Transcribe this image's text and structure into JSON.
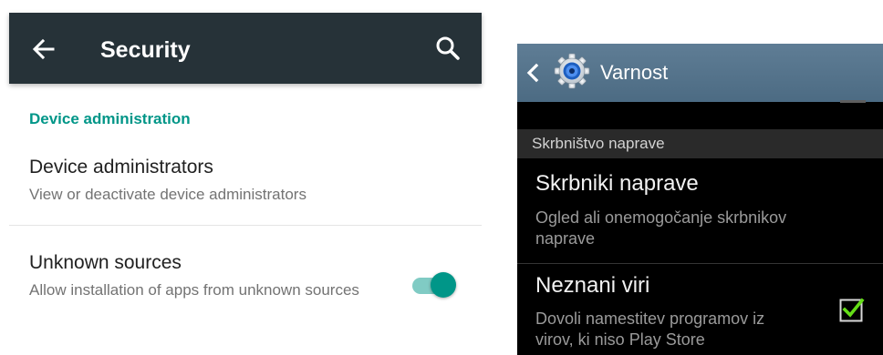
{
  "lollipop": {
    "appbar": {
      "title": "Security",
      "back_icon": "arrow-left-icon",
      "search_icon": "search-icon"
    },
    "section_header": "Device administration",
    "items": [
      {
        "title": "Device administrators",
        "subtitle": "View or deactivate device administrators"
      },
      {
        "title": "Unknown sources",
        "subtitle": "Allow installation of apps from unknown sources",
        "toggle": true
      }
    ],
    "colors": {
      "appbar": "#263238",
      "accent": "#009688",
      "switch_track": "#80cbc4"
    }
  },
  "touchwiz": {
    "appbar": {
      "title": "Varnost",
      "back_icon": "chevron-left-icon",
      "app_icon": "settings-gear-icon"
    },
    "section_header": "Skrbništvo naprave",
    "items": [
      {
        "title": "Skrbniki naprave",
        "subtitle_line1": "Ogled ali onemogočanje skrbnikov",
        "subtitle_line2": "naprave"
      },
      {
        "title": "Neznani viri",
        "subtitle_line1": "Dovoli namestitev programov iz",
        "subtitle_line2": "virov, ki niso Play Store",
        "checked": true
      }
    ],
    "colors": {
      "appbar": "#56758d",
      "background": "#000000",
      "check": "#64dd17"
    }
  }
}
